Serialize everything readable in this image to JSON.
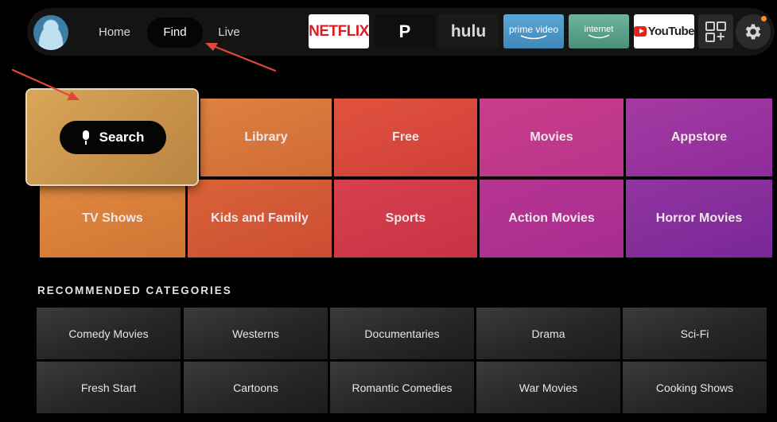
{
  "nav": {
    "items": [
      {
        "label": "Home"
      },
      {
        "label": "Find"
      },
      {
        "label": "Live"
      }
    ]
  },
  "apps": {
    "netflix": "NETFLIX",
    "plex": "P",
    "hulu": "hulu",
    "prime": "prime video",
    "internet": "internet",
    "youtube": "YouTube"
  },
  "find": {
    "search_label": "Search",
    "tiles": [
      {
        "label": "Library"
      },
      {
        "label": "Free"
      },
      {
        "label": "Movies"
      },
      {
        "label": "Appstore"
      },
      {
        "label": "TV Shows"
      },
      {
        "label": "Kids and Family"
      },
      {
        "label": "Sports"
      },
      {
        "label": "Action Movies"
      },
      {
        "label": "Horror Movies"
      }
    ]
  },
  "recommended": {
    "heading": "RECOMMENDED CATEGORIES",
    "items": [
      {
        "label": "Comedy Movies"
      },
      {
        "label": "Westerns"
      },
      {
        "label": "Documentaries"
      },
      {
        "label": "Drama"
      },
      {
        "label": "Sci-Fi"
      },
      {
        "label": "Fresh Start"
      },
      {
        "label": "Cartoons"
      },
      {
        "label": "Romantic Comedies"
      },
      {
        "label": "War Movies"
      },
      {
        "label": "Cooking Shows"
      }
    ]
  },
  "colors": {
    "arrow": "#e0493a",
    "notification": "#ff8a1f",
    "selected_tile": "#d9a659"
  }
}
